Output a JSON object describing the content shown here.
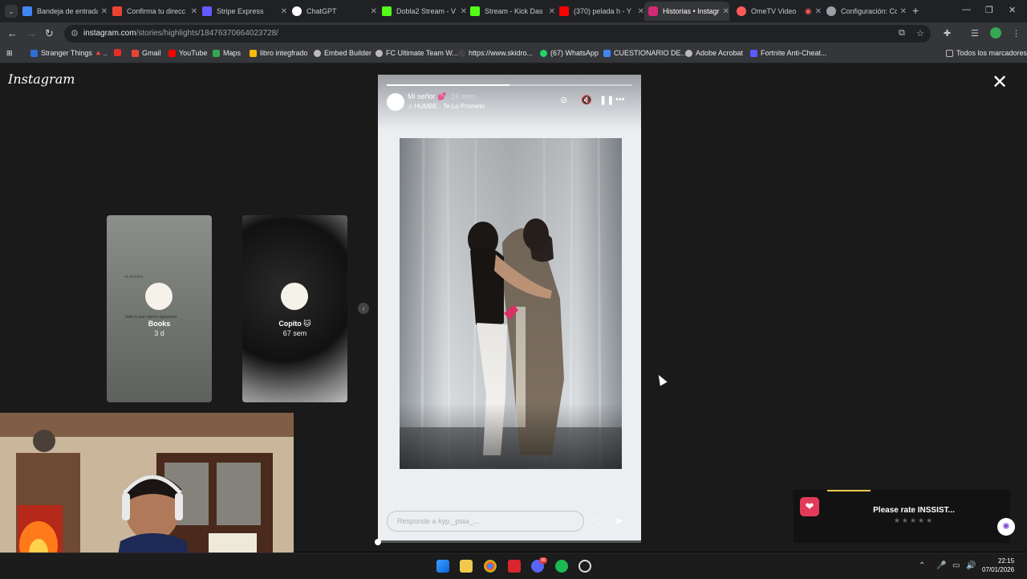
{
  "browser": {
    "tabs": [
      {
        "title": "Bandeja de entrada",
        "color": "#4285f4"
      },
      {
        "title": "Confirma tu direcc",
        "color": "#ea4335"
      },
      {
        "title": "Stripe Express",
        "color": "#635bff"
      },
      {
        "title": "ChatGPT",
        "color": "#ffffff"
      },
      {
        "title": "Dobla2 Stream - V",
        "color": "#53fc18"
      },
      {
        "title": "Stream - Kick Das",
        "color": "#53fc18"
      },
      {
        "title": "(370) pelada h - Y",
        "color": "#ff0000"
      },
      {
        "title": "Historias • Instagr",
        "color": "#d62976",
        "active": true
      },
      {
        "title": "OmeTV Video",
        "color": "#ff5a5a"
      },
      {
        "title": "Configuración: Co",
        "color": "#9aa0a6"
      }
    ],
    "url_host": "instagram.com",
    "url_path": "/stories/highlights/18476370664023728/",
    "bookmarks": [
      {
        "label": "Stranger Things 🔺..",
        "color": "#2d6fd6"
      },
      {
        "label": "",
        "color": "#e52d27"
      },
      {
        "label": "Gmail",
        "color": "#ea4335"
      },
      {
        "label": "YouTube",
        "color": "#ff0000"
      },
      {
        "label": "Maps",
        "color": "#34a853"
      },
      {
        "label": "libro integfrado",
        "color": "#fbbc04"
      },
      {
        "label": "Embed Builder",
        "color": "#bbbbbb"
      },
      {
        "label": "FC Ultimate Team W...",
        "color": "#bbbbbb"
      },
      {
        "label": "https://www.skidro...",
        "color": "#444444"
      },
      {
        "label": "(67) WhatsApp",
        "color": "#25d366"
      },
      {
        "label": "CUESTIONARIO DE...",
        "color": "#4285f4"
      },
      {
        "label": "Adobe Acrobat",
        "color": "#bbbbbb"
      },
      {
        "label": "Fortnite Anti-Cheat...",
        "color": "#5b5bff"
      }
    ],
    "all_bookmarks_label": "Todos los marcadores"
  },
  "instagram": {
    "logo": "Instagram",
    "previews": [
      {
        "name": "Books",
        "time": "3 d",
        "text_1": "se terminó",
        "text_2": "Todo lo que vamos lograndos."
      },
      {
        "name": "Copito 🐱",
        "time": "67 sem"
      }
    ],
    "story": {
      "user": "Mi señor 💕",
      "ago": "16 sem",
      "music": "HUMBE · Te Lo Prometo",
      "progress": 0.5,
      "reply_placeholder": "Responde a kyp._piaa_..."
    }
  },
  "popup": {
    "message": "Please rate INSSIST...",
    "stars": "★★★★★"
  },
  "taskbar": {
    "time": "22:15",
    "date": "07/01/2026",
    "discord_badge": "99"
  }
}
